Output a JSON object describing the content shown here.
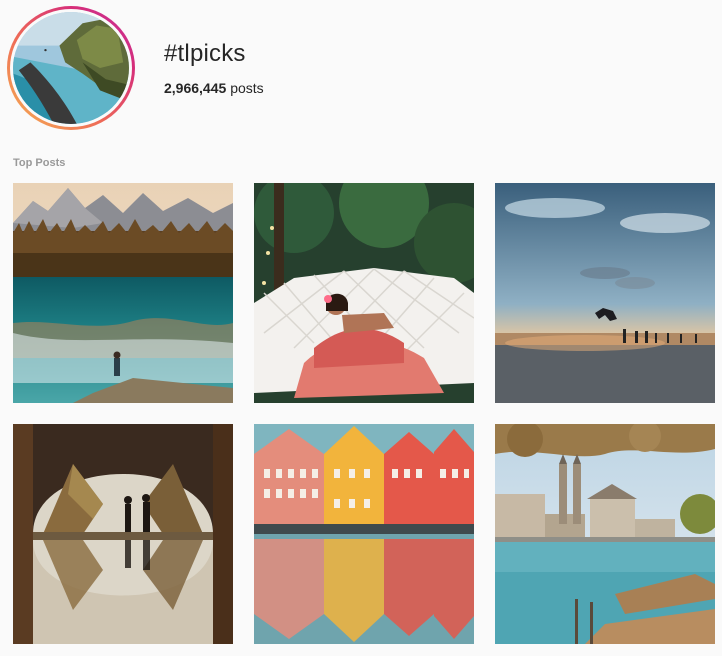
{
  "header": {
    "hashtag": "#tlpicks",
    "post_count": "2,966,445",
    "post_label": "posts"
  },
  "section": {
    "title": "Top Posts"
  },
  "posts": [
    {
      "icon": "mountain-lake-photo"
    },
    {
      "icon": "woman-in-hammock-photo"
    },
    {
      "icon": "beach-sunset-jump-photo"
    },
    {
      "icon": "couple-in-tunnel-photo"
    },
    {
      "icon": "colorful-houses-reflection-photo"
    },
    {
      "icon": "lakeside-city-photo"
    }
  ],
  "colors": {
    "ring_start": "#f6b453",
    "ring_end": "#c22fa0",
    "section_title": "#999999"
  }
}
